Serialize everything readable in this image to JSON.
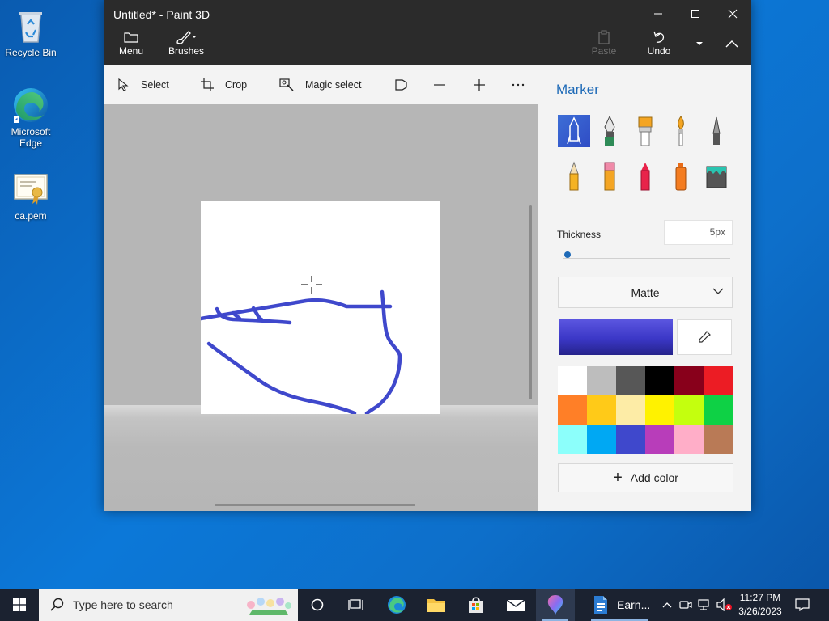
{
  "desktop": {
    "icons": [
      {
        "label": "Recycle Bin",
        "icon": "recycle-bin-icon"
      },
      {
        "label": "Microsoft Edge",
        "label_line1": "Microsoft",
        "label_line2": "Edge",
        "icon": "edge-icon"
      },
      {
        "label": "ca.pem",
        "icon": "certificate-icon"
      }
    ]
  },
  "window": {
    "title": "Untitled* - Paint 3D",
    "toolbar": {
      "menu_label": "Menu",
      "brushes_label": "Brushes",
      "paste_label": "Paste",
      "undo_label": "Undo"
    },
    "tools": {
      "select_label": "Select",
      "crop_label": "Crop",
      "magic_select_label": "Magic select"
    }
  },
  "panel": {
    "title": "Marker",
    "brushes": [
      "marker",
      "calligraphy-pen",
      "oil-brush",
      "watercolor",
      "pixel-pen",
      "pencil",
      "eraser",
      "crayon",
      "spray-can",
      "fill"
    ],
    "selected_brush": "marker",
    "thickness_label": "Thickness",
    "thickness_value": "5px",
    "thickness_level": 0.01,
    "finish_value": "Matte",
    "current_color": "#3b37c6",
    "palette": [
      "#ffffff",
      "#bdbdbd",
      "#575757",
      "#000000",
      "#88001b",
      "#ec1c24",
      "#ff7f27",
      "#ffca18",
      "#fdeca6",
      "#fff200",
      "#c4ff0e",
      "#0ed145",
      "#8cfffb",
      "#00a8f3",
      "#3f48cc",
      "#b83dba",
      "#ffaec8",
      "#b97a56"
    ],
    "add_color_label": "Add color"
  },
  "taskbar": {
    "search_placeholder": "Type here to search",
    "word_app_label": "Earn...",
    "time": "11:27 PM",
    "date": "3/26/2023"
  }
}
